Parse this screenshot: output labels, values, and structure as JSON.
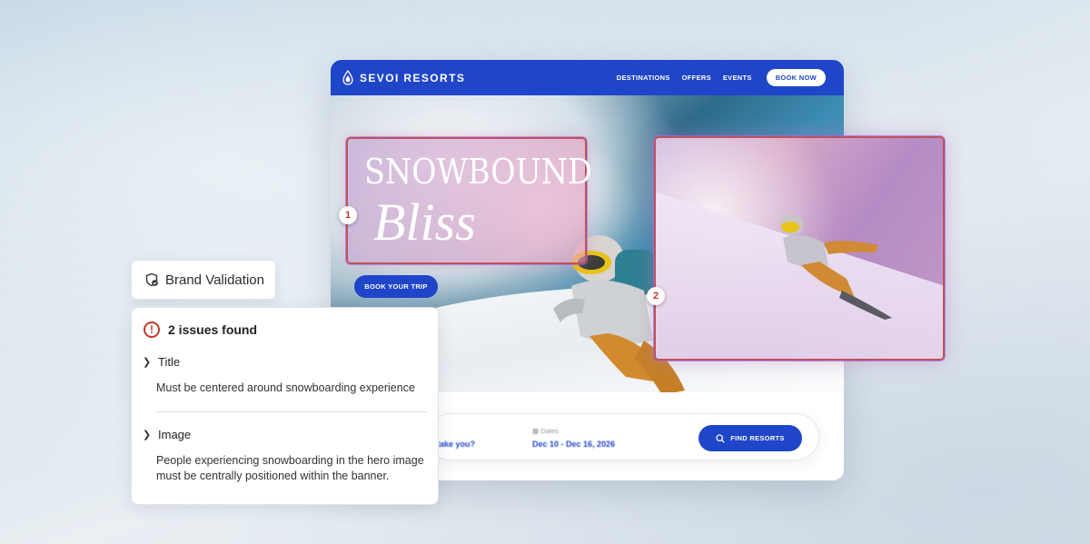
{
  "site": {
    "brand_name": "SEVOI RESORTS",
    "nav": [
      "DESTINATIONS",
      "OFFERS",
      "EVENTS"
    ],
    "book_now": "BOOK NOW",
    "hero_title_line1": "SNOWBOUND",
    "hero_title_line2": "Bliss",
    "book_trip": "BOOK YOUR TRIP",
    "search": {
      "question_fragment": "take you?",
      "dates_label": "Dates",
      "dates_value": "Dec 10 - Dec 16, 2026",
      "find_button": "FIND RESORTS"
    },
    "markers": [
      "1",
      "2"
    ]
  },
  "validation": {
    "chip_label": "Brand Validation",
    "issues_count": "2 issues found",
    "issues": [
      {
        "title": "Title",
        "description": "Must be centered around snowboarding experience"
      },
      {
        "title": "Image",
        "description": "People experiencing snowboarding in the hero image must be centrally positioned within the banner."
      }
    ]
  },
  "colors": {
    "brand_blue": "#1f45c9",
    "alert_red": "#c0392b",
    "highlight_border": "#c1505c"
  },
  "icons": [
    "brand-drop-icon",
    "shield-check-icon",
    "alert-icon",
    "chevron-right-icon",
    "search-icon",
    "calendar-icon"
  ]
}
